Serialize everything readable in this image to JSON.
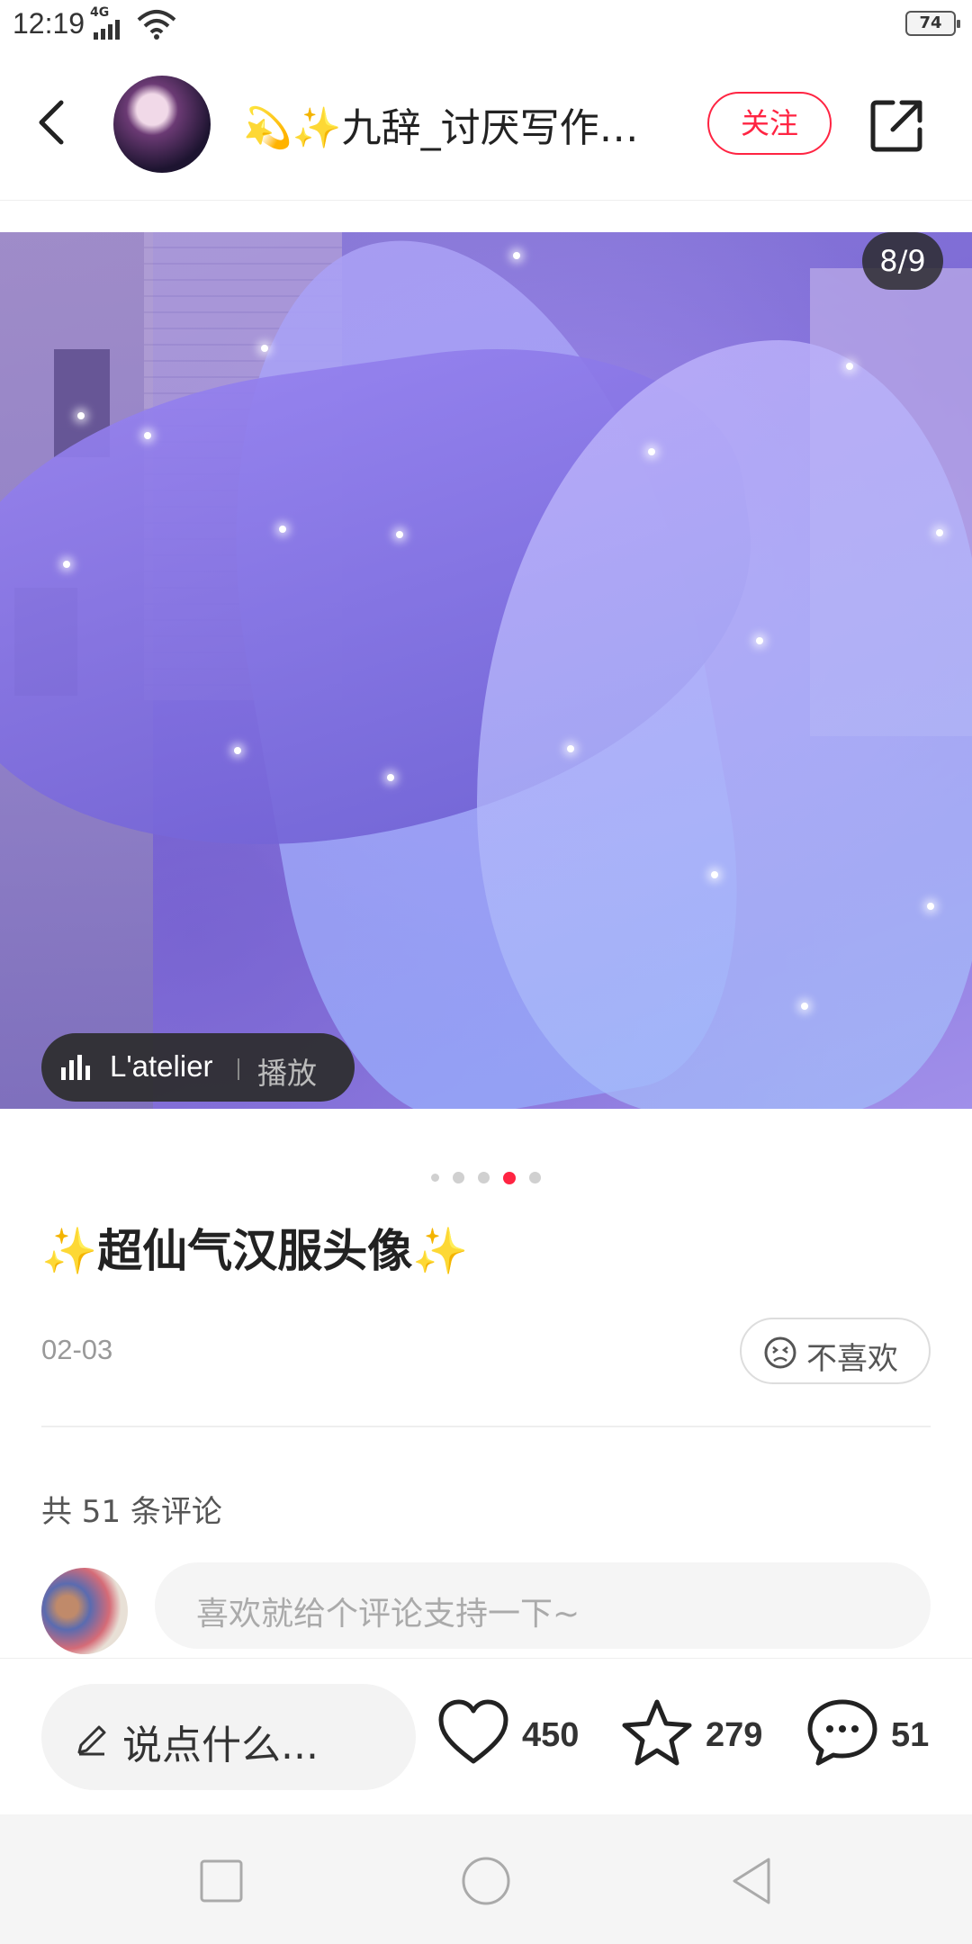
{
  "status_bar": {
    "time": "12:19",
    "network": "4G",
    "battery": "74"
  },
  "header": {
    "author_name": "💫✨九辞_讨厌写作…",
    "follow_label": "关注"
  },
  "image": {
    "page_indicator": "8/9",
    "music_title": "L'atelier",
    "music_play": "播放"
  },
  "carousel": {
    "total_dots": 5,
    "active_index": 3
  },
  "post": {
    "title_prefix": "✨",
    "title": "超仙气汉服头像",
    "title_suffix": "✨",
    "date": "02-03",
    "dislike_label": "不喜欢"
  },
  "comments": {
    "count_text": "共 51 条评论",
    "input_placeholder": "喜欢就给个评论支持一下~"
  },
  "action_bar": {
    "say_placeholder": "说点什么...",
    "like_count": "450",
    "collect_count": "279",
    "comment_count": "51"
  },
  "colors": {
    "accent": "#ff2442",
    "sparkle": "#f5c518"
  }
}
